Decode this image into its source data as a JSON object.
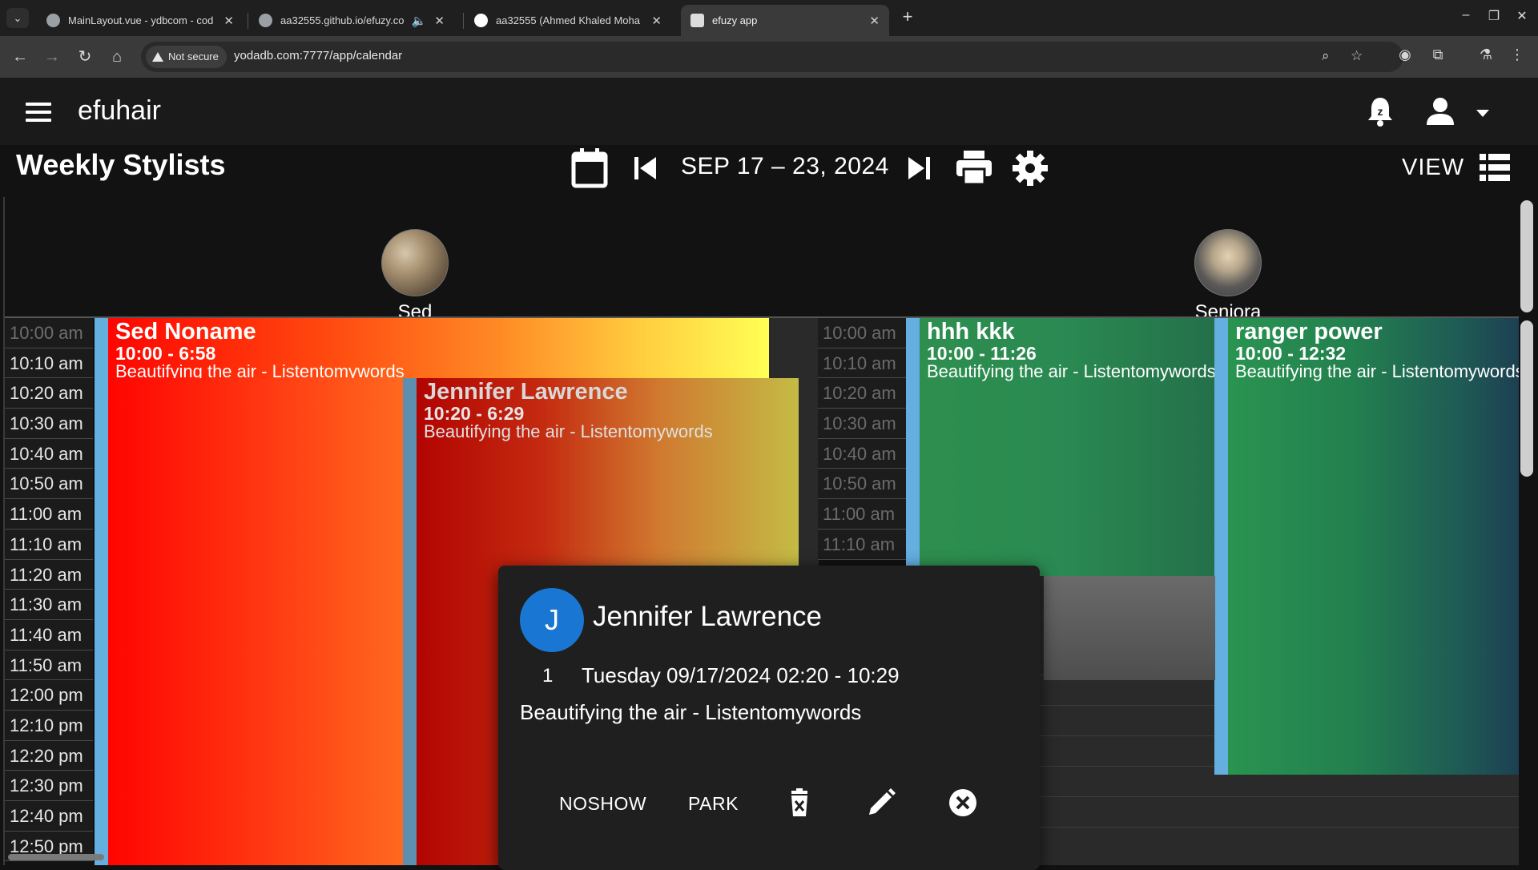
{
  "browser": {
    "tabs": [
      {
        "title": "MainLayout.vue - ydbcom - cod",
        "favicon_color": "#9aa0a6",
        "active": false
      },
      {
        "title": "aa32555.github.io/efuzy.co",
        "favicon_color": "#9aa0a6",
        "active": false
      },
      {
        "title": "aa32555 (Ahmed Khaled Moha",
        "favicon_color": "#ffffff",
        "active": false
      },
      {
        "title": "efuzy app",
        "favicon_color": "#dddddd",
        "active": true
      }
    ],
    "security_label": "Not secure",
    "url": "yodadb.com:7777/app/calendar"
  },
  "app": {
    "brand": "efuhair",
    "page_title": "Weekly Stylists",
    "date_range": "SEP 17 – 23, 2024",
    "view_label": "VIEW"
  },
  "stylists": [
    {
      "name": "Sed"
    },
    {
      "name": "Seniora"
    }
  ],
  "times": [
    "10:00 am",
    "10:10 am",
    "10:20 am",
    "10:30 am",
    "10:40 am",
    "10:50 am",
    "11:00 am",
    "11:10 am",
    "11:20 am",
    "11:30 am",
    "11:40 am",
    "11:50 am",
    "12:00 pm",
    "12:10 pm",
    "12:20 pm",
    "12:30 pm",
    "12:40 pm",
    "12:50 pm"
  ],
  "times_second": [
    "10:00 am",
    "10:10 am",
    "10:20 am",
    "10:30 am",
    "10:40 am",
    "10:50 am",
    "11:00 am",
    "11:10 am"
  ],
  "events": [
    {
      "name": "Sed Noname",
      "time": "10:00 - 6:58",
      "desc": "Beautifying the air - Listentomywords"
    },
    {
      "name": "Jennifer Lawrence",
      "time": "10:20 - 6:29",
      "desc": "Beautifying the air - Listentomywords"
    },
    {
      "name": "hhh kkk",
      "time": "10:00 - 11:26",
      "desc": "Beautifying the air - Listentomywords"
    },
    {
      "name": "ranger power",
      "time": "10:00 - 12:32",
      "desc": "Beautifying the air - Listentomywords"
    }
  ],
  "popup": {
    "initial": "J",
    "name": "Jennifer Lawrence",
    "count": "1",
    "date": "Tuesday 09/17/2024 02:20 - 10:29",
    "desc": "Beautifying the air - Listentomywords",
    "noshow_label": "NOSHOW",
    "park_label": "PARK",
    "avatar_color": "#1976d2"
  },
  "colors": {
    "accent_bar": "#64aee0",
    "background": "#121212"
  }
}
